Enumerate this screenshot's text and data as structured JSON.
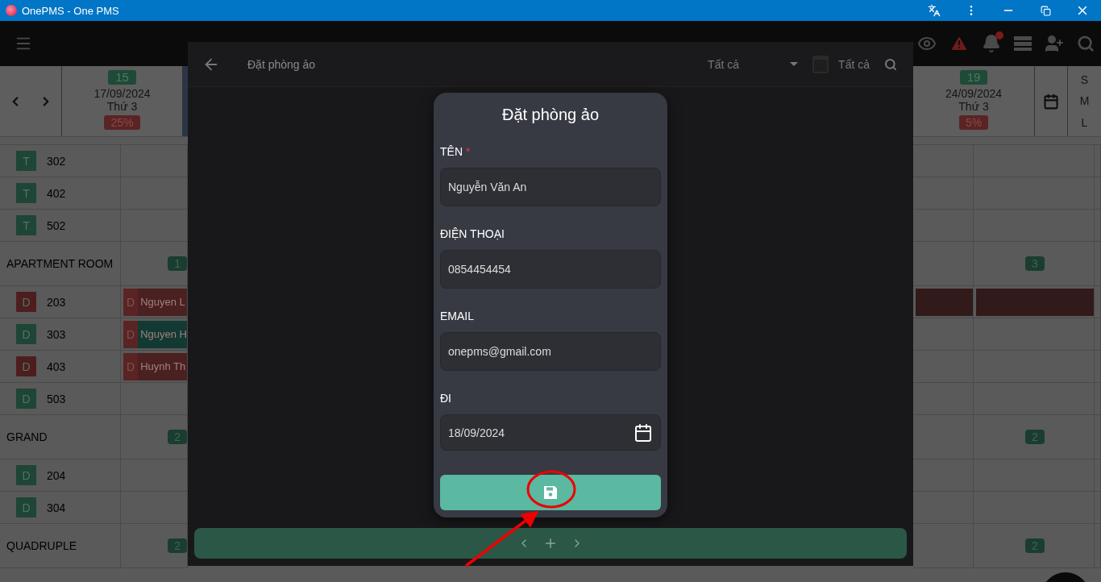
{
  "window": {
    "title": "OnePMS - One PMS"
  },
  "calendar": {
    "left_dates": [
      {
        "count": "15",
        "date": "17/09/2024",
        "weekday": "Thứ 3",
        "occupancy": "25%"
      }
    ],
    "right_dates": [
      {
        "count": "19",
        "date": "24/09/2024",
        "weekday": "Thứ 3",
        "occupancy": "5%"
      }
    ],
    "sizes": [
      "S",
      "M",
      "L"
    ],
    "rows": [
      {
        "kind": "room",
        "type": "T",
        "color": "#1e4536",
        "number": "302"
      },
      {
        "kind": "room",
        "type": "T",
        "color": "#1e4536",
        "number": "402"
      },
      {
        "kind": "room",
        "type": "T",
        "color": "#1e4536",
        "number": "502"
      },
      {
        "kind": "group",
        "name": "APARTMENT ROOM",
        "left_count": "1",
        "right_count": "3"
      },
      {
        "kind": "room",
        "type": "D",
        "color": "#4e1e1e",
        "number": "203",
        "booking": {
          "code": {
            "text": "D",
            "color": "#5a2424"
          },
          "guest": "Nguyen L",
          "color": "#4a2020"
        },
        "right_booking": {
          "color": "#321a1a"
        }
      },
      {
        "kind": "room",
        "type": "D",
        "color": "#1e4536",
        "number": "303",
        "booking": {
          "code": {
            "text": "D",
            "color": "#5a2424"
          },
          "guest": "Nguyen H",
          "color": "#123a32"
        }
      },
      {
        "kind": "room",
        "type": "D",
        "color": "#4e1e1e",
        "number": "403",
        "booking": {
          "code": {
            "text": "D",
            "color": "#5a2424"
          },
          "guest": "Huynh Th",
          "color": "#4a2020"
        }
      },
      {
        "kind": "room",
        "type": "D",
        "color": "#1e4536",
        "number": "503"
      },
      {
        "kind": "group",
        "name": "GRAND",
        "left_count": "2",
        "right_count": "2"
      },
      {
        "kind": "room",
        "type": "D",
        "color": "#1e4536",
        "number": "204"
      },
      {
        "kind": "room",
        "type": "D",
        "color": "#1e4536",
        "number": "304"
      },
      {
        "kind": "group",
        "name": "QUADRUPLE",
        "left_count": "2",
        "right_count": "2"
      }
    ]
  },
  "modal": {
    "title": "Đặt phòng ảo",
    "status_filter": "Tất cả",
    "date_filter": "Tất cả"
  },
  "dialog": {
    "title": "Đặt phòng ảo",
    "fields": [
      {
        "kind": "text",
        "label": "TÊN",
        "required_mark": "*",
        "value": "Nguyễn Văn An"
      },
      {
        "kind": "text",
        "label": "ĐIỆN THOẠI",
        "value": "0854454454"
      },
      {
        "kind": "text",
        "label": "EMAIL",
        "value": "onepms@gmail.com"
      },
      {
        "kind": "date",
        "label": "ĐI",
        "value": "18/09/2024"
      }
    ]
  }
}
